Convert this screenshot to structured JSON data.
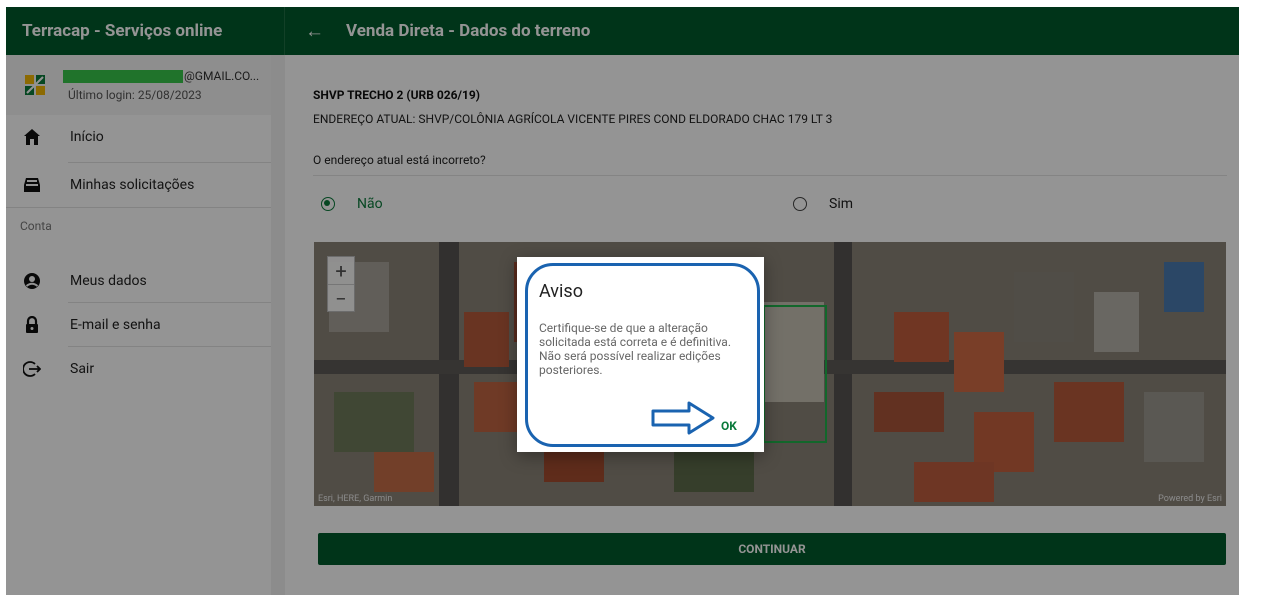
{
  "sidebar": {
    "app_title": "Terracap - Serviços online",
    "user_email_suffix": "@GMAIL.CO...",
    "last_login": "Último login: 25/08/2023",
    "items": [
      {
        "label": "Início",
        "icon": "home-icon"
      },
      {
        "label": "Minhas solicitações",
        "icon": "inbox-icon"
      }
    ],
    "section_conta": "Conta",
    "account_items": [
      {
        "label": "Meus dados",
        "icon": "account-circle-icon"
      },
      {
        "label": "E-mail e senha",
        "icon": "lock-icon"
      },
      {
        "label": "Sair",
        "icon": "logout-icon"
      }
    ]
  },
  "header": {
    "back_icon": "←",
    "page_title": "Venda Direta - Dados do terreno"
  },
  "main": {
    "lot_title": "SHVP TRECHO 2 (URB 026/19)",
    "current_address": "ENDEREÇO ATUAL: SHVP/COLÔNIA AGRÍCOLA VICENTE PIRES COND ELDORADO CHAC 179 LT 3",
    "question": "O endereço atual está incorreto?",
    "option_no": "Não",
    "option_yes": "Sim",
    "selected_option": "Não",
    "map": {
      "zoom_in": "+",
      "zoom_out": "−",
      "attribution": "Esri, HERE, Garmin",
      "powered_by": "Powered by Esri"
    },
    "continue_label": "CONTINUAR"
  },
  "dialog": {
    "title": "Aviso",
    "message": "Certifique-se de que a alteração solicitada está correta e é definitiva. Não será possível realizar edições posteriores.",
    "ok_label": "OK"
  },
  "colors": {
    "brand_green": "#005a2b",
    "accent_green": "#0b7a3b",
    "highlight_blue": "#1a63b0"
  }
}
